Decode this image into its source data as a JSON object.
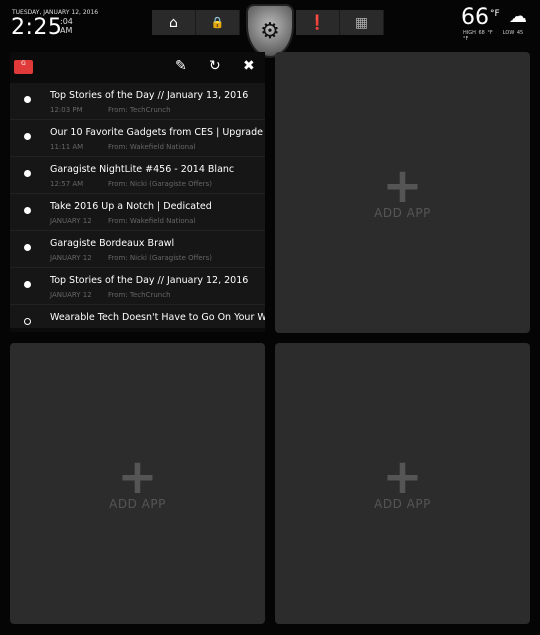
{
  "clock": {
    "date": "TUESDAY, JANUARY 12, 2016",
    "time": "2:25",
    "seconds": ":04",
    "ampm": "AM"
  },
  "nav": {
    "items": [
      {
        "name": "garage-icon",
        "glyph": "⌂"
      },
      {
        "name": "lock-icon",
        "glyph": "🔒"
      },
      {
        "name": "settings-gear-icon",
        "glyph": "⚙"
      },
      {
        "name": "alert-icon",
        "glyph": "❗"
      },
      {
        "name": "apps-grid-icon",
        "glyph": "▦"
      }
    ]
  },
  "weather": {
    "temp": "66",
    "unit": "°F",
    "high": "HIGH 68 °F",
    "low": "LOW 45 °F",
    "icon": "rain-cloud-icon"
  },
  "mail": {
    "badge": "G",
    "emails": [
      {
        "subject": "Top Stories of the Day // January 13, 2016",
        "when": "12:03 PM",
        "from": "From: TechCrunch",
        "read": false
      },
      {
        "subject": "Our 10 Favorite Gadgets from CES | Upgrade",
        "when": "11:11 AM",
        "from": "From: Wakefield National",
        "read": false
      },
      {
        "subject": "Garagiste NightLite #456 - 2014 Blanc",
        "when": "12:57 AM",
        "from": "From: Nicki (Garagiste Offers)",
        "read": false
      },
      {
        "subject": "Take 2016 Up a Notch | Dedicated",
        "when": "JANUARY 12",
        "from": "From: Wakefield National",
        "read": false
      },
      {
        "subject": "Garagiste Bordeaux Brawl",
        "when": "JANUARY 12",
        "from": "From: Nicki (Garagiste Offers)",
        "read": false
      },
      {
        "subject": "Top Stories of the Day // January 12, 2016",
        "when": "JANUARY 12",
        "from": "From: TechCrunch",
        "read": false
      },
      {
        "subject": "Wearable Tech Doesn't Have to Go On Your Wr",
        "when": "",
        "from": "",
        "read": true
      }
    ]
  },
  "tiles": {
    "plus": "+",
    "add_label": "ADD APP"
  },
  "colors": {
    "accent": "#e03a3a",
    "tile": "#2c2c2c"
  }
}
